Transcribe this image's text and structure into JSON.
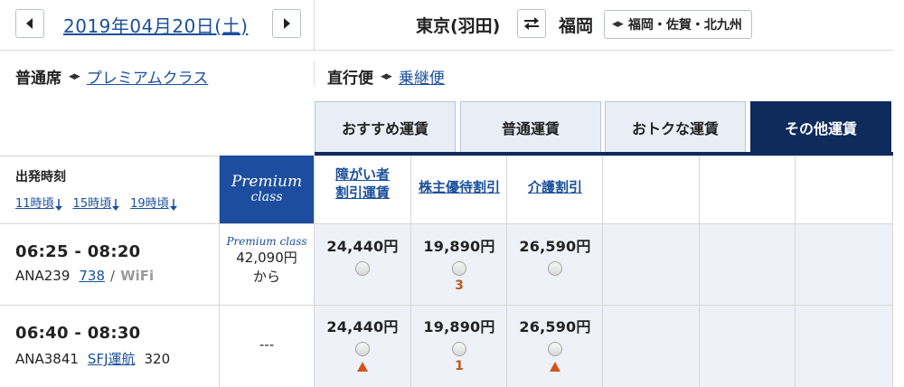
{
  "header": {
    "date": "2019年04月20日(土)",
    "origin": "東京(羽田)",
    "destination": "福岡",
    "destination_select": "福岡・佐賀・北九州"
  },
  "filters": {
    "cabin_label": "普通席",
    "cabin_link": "プレミアムクラス",
    "route_label": "直行便",
    "route_link": "乗継便"
  },
  "tabs": [
    {
      "label": "おすすめ運賃",
      "active": false
    },
    {
      "label": "普通運賃",
      "active": false
    },
    {
      "label": "おトクな運賃",
      "active": false
    },
    {
      "label": "その他運賃",
      "active": true
    }
  ],
  "table_header": {
    "departure_time": "出発時刻",
    "time_links": [
      "11時頃",
      "15時頃",
      "19時頃"
    ],
    "premium_line1": "Premium",
    "premium_line2": "class",
    "fare_columns": [
      {
        "line1": "障がい者",
        "line2": "割引運賃"
      },
      {
        "line1": "株主優待割引",
        "line2": ""
      },
      {
        "line1": "介護割引",
        "line2": ""
      }
    ]
  },
  "flights": [
    {
      "time": "06:25 - 08:20",
      "flight_no": "ANA239",
      "aircraft": "738",
      "separator": "/",
      "extra": "WiFi",
      "premium_label": "Premium class",
      "premium_price": "42,090円",
      "premium_suffix": "から",
      "fares": [
        {
          "price": "24,440円",
          "note": ""
        },
        {
          "price": "19,890円",
          "note": "3"
        },
        {
          "price": "26,590円",
          "note": ""
        }
      ]
    },
    {
      "time": "06:40 - 08:30",
      "flight_no": "ANA3841",
      "operator": "SFJ運航",
      "aircraft": "320",
      "premium_dash": "---",
      "fares": [
        {
          "price": "24,440円",
          "note": "triangle"
        },
        {
          "price": "19,890円",
          "note": "1"
        },
        {
          "price": "26,590円",
          "note": "triangle"
        }
      ]
    }
  ],
  "colors": {
    "link": "#1a4f9c",
    "active_tab": "#0f2a5c",
    "premium_blue": "#1c4d9e",
    "seat_warning": "#d2541a"
  }
}
